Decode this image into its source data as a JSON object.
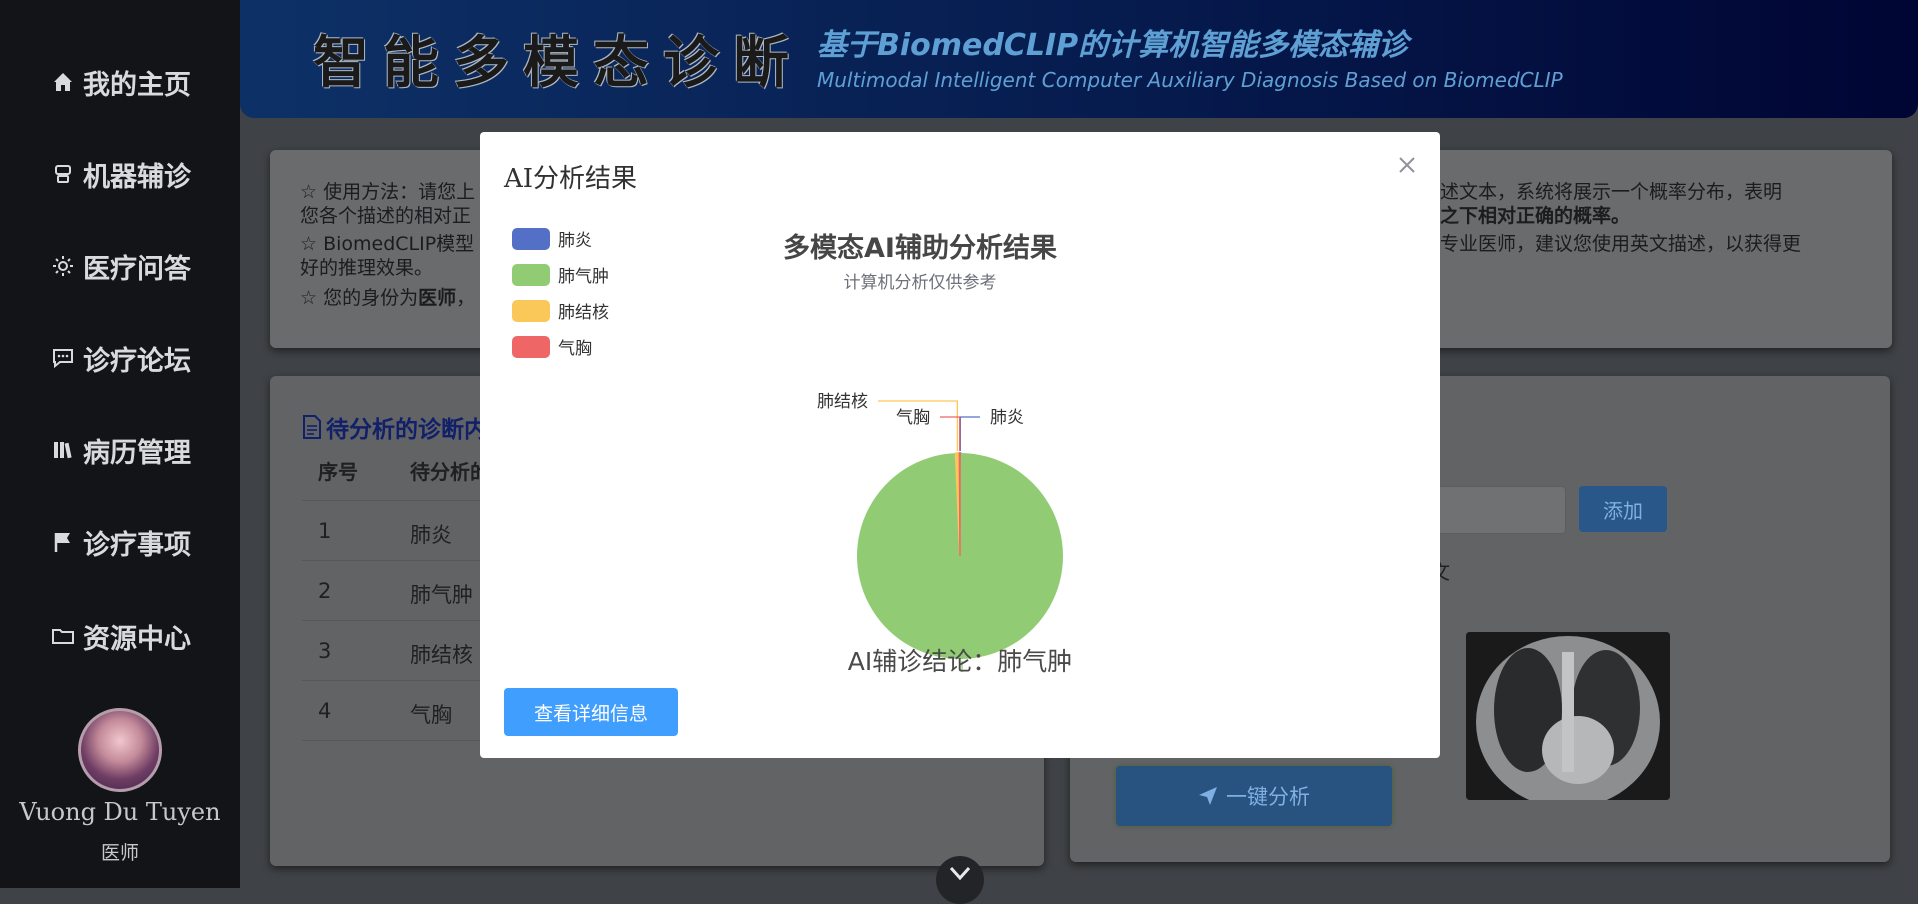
{
  "sidebar": {
    "items": [
      {
        "label": "我的主页",
        "icon": "home-icon"
      },
      {
        "label": "机器辅诊",
        "icon": "robot-icon"
      },
      {
        "label": "医疗问答",
        "icon": "sun-icon"
      },
      {
        "label": "诊疗论坛",
        "icon": "chat-icon"
      },
      {
        "label": "病历管理",
        "icon": "books-icon"
      },
      {
        "label": "诊疗事项",
        "icon": "flag-icon"
      },
      {
        "label": "资源中心",
        "icon": "folder-icon"
      }
    ],
    "user": {
      "name": "Vuong Du Tuyen",
      "role": "医师"
    }
  },
  "header": {
    "brand": "智能多模态诊断",
    "subtitle_zh": "基于BiomedCLIP的计算机智能多模态辅诊",
    "subtitle_en": "Multimodal Intelligent Computer Auxiliary Diagnosis Based on BiomedCLIP"
  },
  "usage": {
    "line1_left": "☆ 使用方法：请您上",
    "line1_right": "述文本，系统将展示一个概率分布，表明",
    "line2_left": "您各个描述的相对正",
    "line2_right": "之下相对正确的概率。",
    "line3_left": "☆ BiomedCLIP模型",
    "line3_right": "专业医师，建议您使用英文描述，以获得更",
    "line4": "好的推理效果。",
    "line5_prefix": "☆ 您的身份为",
    "line5_role": "医师",
    "line5_suffix": "，"
  },
  "list": {
    "title": "待分析的诊断内",
    "col_index": "序号",
    "col_text": "待分析的",
    "rows": [
      {
        "index": "1",
        "text": "肺炎"
      },
      {
        "index": "2",
        "text": "肺气肿"
      },
      {
        "index": "3",
        "text": "肺结核"
      },
      {
        "index": "4",
        "text": "气胸"
      }
    ]
  },
  "right_panel": {
    "add_label": "添加",
    "partial_text": "文",
    "analyze_label": "一键分析"
  },
  "modal": {
    "title": "AI分析结果",
    "detail_button": "查看详细信息",
    "conclusion": "AI辅诊结论：肺气肿"
  },
  "chart_data": {
    "type": "pie",
    "title": "多模态AI辅助分析结果",
    "subtitle": "计算机分析仅供参考",
    "categories": [
      "肺炎",
      "肺气肿",
      "肺结核",
      "气胸"
    ],
    "values": [
      0.1,
      99.2,
      0.6,
      0.1
    ],
    "colors": [
      "#5470c6",
      "#91cc75",
      "#fac858",
      "#ee6666"
    ],
    "legend_position": "top-left"
  },
  "colors": {
    "accent": "#409eff",
    "sidebar_bg": "#121418",
    "header_text": "#5fa0d4"
  }
}
